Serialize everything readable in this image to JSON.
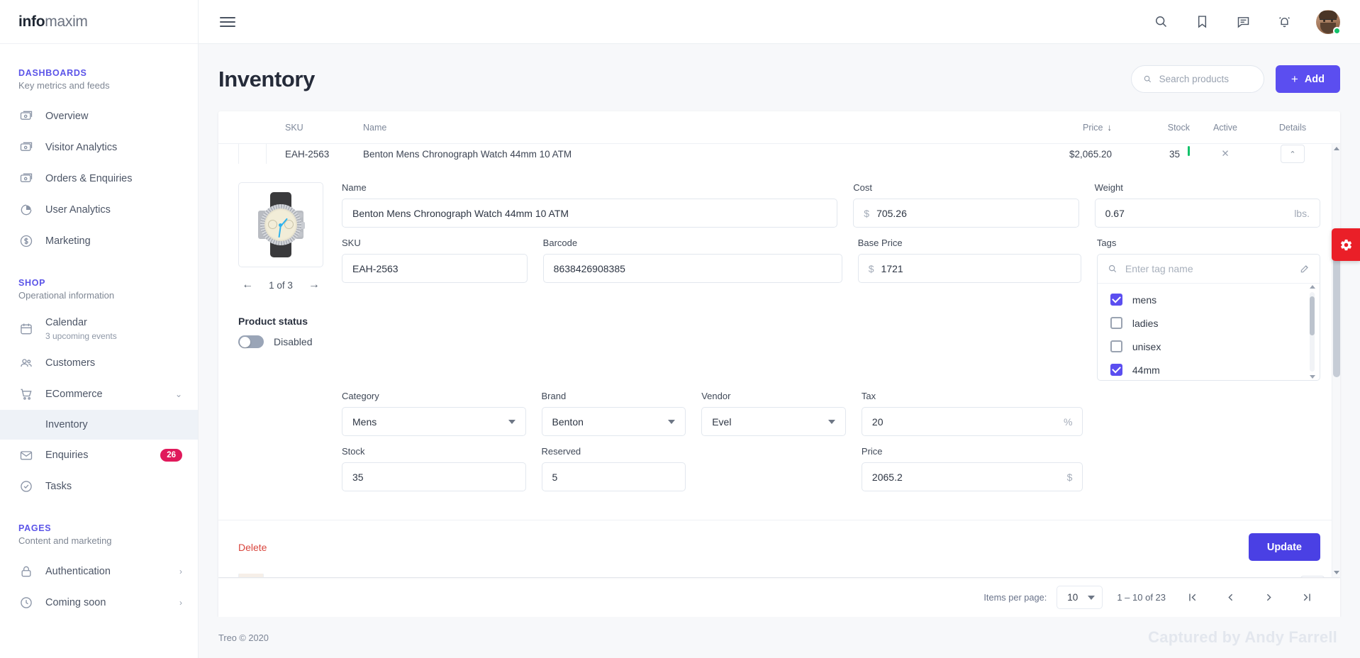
{
  "brand": {
    "logo_bold": "info",
    "logo_light": "maxim"
  },
  "sidebar": {
    "sections": [
      {
        "title": "DASHBOARDS",
        "subtitle": "Key metrics and feeds"
      },
      {
        "title": "SHOP",
        "subtitle": "Operational information"
      },
      {
        "title": "PAGES",
        "subtitle": "Content and marketing"
      }
    ],
    "dashboards": [
      {
        "label": "Overview",
        "icon": "dashboard-icon"
      },
      {
        "label": "Visitor Analytics",
        "icon": "dashboard-icon"
      },
      {
        "label": "Orders & Enquiries",
        "icon": "dashboard-icon"
      },
      {
        "label": "User Analytics",
        "icon": "pie-chart-icon"
      },
      {
        "label": "Marketing",
        "icon": "dollar-circle-icon"
      }
    ],
    "shop": [
      {
        "label": "Calendar",
        "sub": "3 upcoming events",
        "icon": "calendar-icon"
      },
      {
        "label": "Customers",
        "icon": "users-icon"
      },
      {
        "label": "ECommerce",
        "icon": "cart-icon",
        "expanded": true
      },
      {
        "label": "Inventory",
        "child": true,
        "active": true
      },
      {
        "label": "Enquiries",
        "icon": "mail-icon",
        "badge": "26"
      },
      {
        "label": "Tasks",
        "icon": "check-circle-icon"
      }
    ],
    "pages": [
      {
        "label": "Authentication",
        "icon": "lock-icon",
        "chevron": "›"
      },
      {
        "label": "Coming soon",
        "icon": "clock-icon",
        "chevron": "›"
      }
    ]
  },
  "topbar": {
    "menu_icon": "hamburger-icon",
    "icons": [
      "search-icon",
      "bookmark-icon",
      "chat-icon",
      "bell-icon"
    ],
    "avatar_status": "online"
  },
  "page": {
    "title": "Inventory",
    "search_placeholder": "Search products",
    "search_value": "",
    "add_label": "Add"
  },
  "table": {
    "columns": [
      "SKU",
      "Name",
      "Price",
      "Stock",
      "Active",
      "Details"
    ],
    "sort_column": "Price",
    "sort_direction": "desc",
    "expanded_row": {
      "sku": "EAH-2563",
      "name": "Benton Mens Chronograph Watch 44mm 10 ATM",
      "price": "$2,065.20",
      "stock": "35",
      "active": "✕",
      "details": "⌃"
    }
  },
  "form": {
    "carousel": {
      "position": "1 of 3",
      "prev": "←",
      "next": "→"
    },
    "product_status_label": "Product status",
    "product_status_value": "Disabled",
    "fields": {
      "name": {
        "label": "Name",
        "value": "Benton Mens Chronograph Watch 44mm 10 ATM"
      },
      "sku": {
        "label": "SKU",
        "value": "EAH-2563"
      },
      "barcode": {
        "label": "Barcode",
        "value": "8638426908385"
      },
      "category": {
        "label": "Category",
        "value": "Mens"
      },
      "brand": {
        "label": "Brand",
        "value": "Benton"
      },
      "vendor": {
        "label": "Vendor",
        "value": "Evel"
      },
      "stock": {
        "label": "Stock",
        "value": "35"
      },
      "reserved": {
        "label": "Reserved",
        "value": "5"
      },
      "cost": {
        "label": "Cost",
        "value": "705.26",
        "prefix": "$"
      },
      "base_price": {
        "label": "Base Price",
        "value": "1721",
        "prefix": "$"
      },
      "tax": {
        "label": "Tax",
        "value": "20",
        "suffix": "%"
      },
      "price": {
        "label": "Price",
        "value": "2065.2",
        "suffix": "$"
      },
      "weight": {
        "label": "Weight",
        "value": "0.67",
        "suffix": "lbs."
      }
    },
    "tags": {
      "label": "Tags",
      "placeholder": "Enter tag name",
      "value": "",
      "items": [
        {
          "label": "mens",
          "checked": true
        },
        {
          "label": "ladies",
          "checked": false
        },
        {
          "label": "unisex",
          "checked": false
        },
        {
          "label": "44mm",
          "checked": true
        }
      ]
    },
    "delete_label": "Delete",
    "update_label": "Update"
  },
  "paginator": {
    "items_per_page_label": "Items per page:",
    "items_per_page_value": "10",
    "range_label": "1 – 10 of 23"
  },
  "footer": {
    "copyright": "Treo © 2020",
    "watermark": "Captured by Andy Farrell"
  },
  "colors": {
    "accent": "#5b4ef0",
    "badge": "#e0195b",
    "danger": "#d9453d",
    "settings_tab": "#ea1f28",
    "status_online": "#13c26b"
  }
}
